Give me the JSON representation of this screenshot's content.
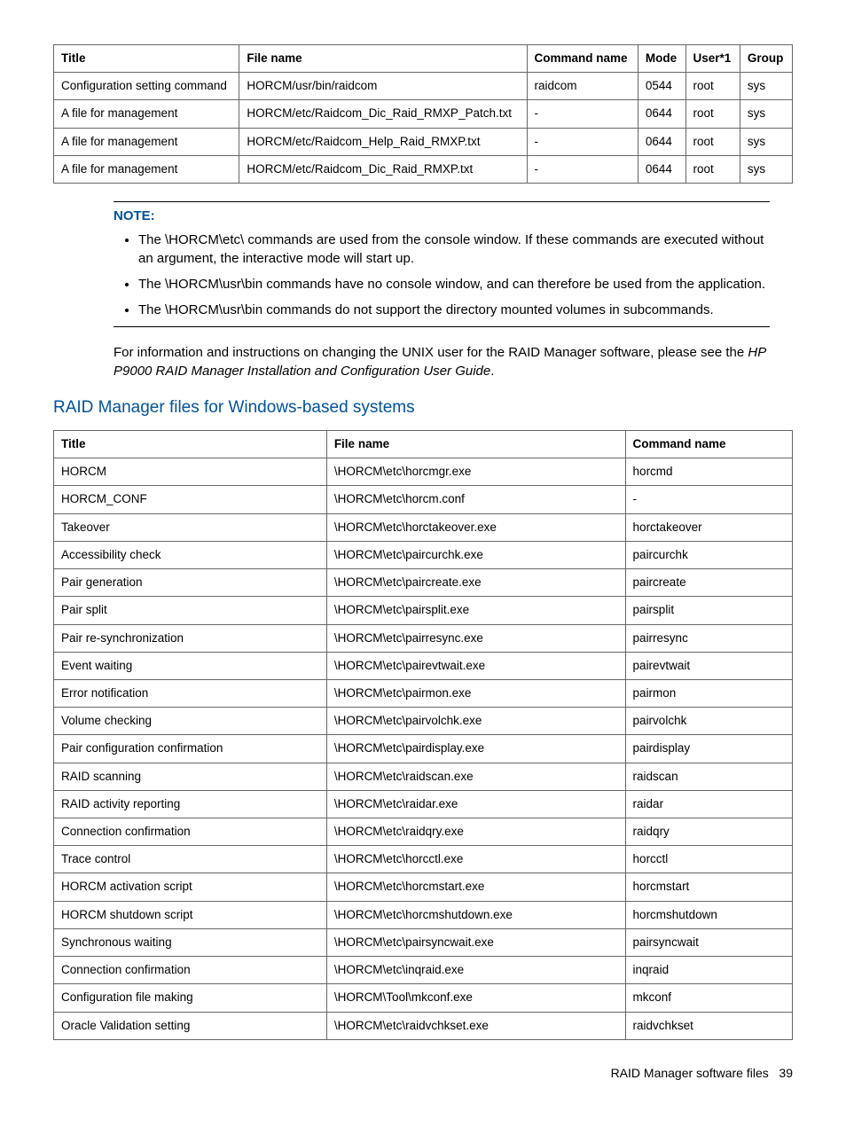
{
  "table1": {
    "headers": [
      "Title",
      "File name",
      "Command name",
      "Mode",
      "User*1",
      "Group"
    ],
    "rows": [
      {
        "c0": "Configuration setting command",
        "c1": "HORCM/usr/bin/raidcom",
        "c2": "raidcom",
        "c3": "0544",
        "c4": "root",
        "c5": "sys"
      },
      {
        "c0": "A file for management",
        "c1": "HORCM/etc/Raidcom_Dic_Raid_RMXP_Patch.txt",
        "c2": "-",
        "c3": "0644",
        "c4": "root",
        "c5": "sys"
      },
      {
        "c0": "A file for management",
        "c1": "HORCM/etc/Raidcom_Help_Raid_RMXP.txt",
        "c2": "-",
        "c3": "0644",
        "c4": "root",
        "c5": "sys"
      },
      {
        "c0": "A file for management",
        "c1": "HORCM/etc/Raidcom_Dic_Raid_RMXP.txt",
        "c2": "-",
        "c3": "0644",
        "c4": "root",
        "c5": "sys"
      }
    ]
  },
  "note": {
    "title": "NOTE:",
    "items": [
      "The \\HORCM\\etc\\ commands are used from the console window. If these commands are executed without an argument, the interactive mode will start up.",
      "The \\HORCM\\usr\\bin commands have no console window, and can therefore be used from the application.",
      "The \\HORCM\\usr\\bin commands do not support the directory mounted volumes in subcommands."
    ]
  },
  "after_note_1": "For information and instructions on changing the UNIX user for the RAID Manager software, please see the ",
  "after_note_doc": "HP P9000 RAID Manager Installation and Configuration User Guide",
  "after_note_2": ".",
  "section_title": "RAID Manager files for Windows-based systems",
  "table2": {
    "headers": [
      "Title",
      "File name",
      "Command name"
    ],
    "rows": [
      {
        "c0": "HORCM",
        "c1": "\\HORCM\\etc\\horcmgr.exe",
        "c2": "horcmd"
      },
      {
        "c0": "HORCM_CONF",
        "c1": "\\HORCM\\etc\\horcm.conf",
        "c2": "-"
      },
      {
        "c0": "Takeover",
        "c1": "\\HORCM\\etc\\horctakeover.exe",
        "c2": "horctakeover"
      },
      {
        "c0": "Accessibility check",
        "c1": "\\HORCM\\etc\\paircurchk.exe",
        "c2": "paircurchk"
      },
      {
        "c0": "Pair generation",
        "c1": "\\HORCM\\etc\\paircreate.exe",
        "c2": "paircreate"
      },
      {
        "c0": "Pair split",
        "c1": "\\HORCM\\etc\\pairsplit.exe",
        "c2": "pairsplit"
      },
      {
        "c0": "Pair re-synchronization",
        "c1": "\\HORCM\\etc\\pairresync.exe",
        "c2": "pairresync"
      },
      {
        "c0": "Event waiting",
        "c1": "\\HORCM\\etc\\pairevtwait.exe",
        "c2": "pairevtwait"
      },
      {
        "c0": "Error notification",
        "c1": "\\HORCM\\etc\\pairmon.exe",
        "c2": "pairmon"
      },
      {
        "c0": "Volume checking",
        "c1": "\\HORCM\\etc\\pairvolchk.exe",
        "c2": "pairvolchk"
      },
      {
        "c0": "Pair configuration confirmation",
        "c1": "\\HORCM\\etc\\pairdisplay.exe",
        "c2": "pairdisplay"
      },
      {
        "c0": "RAID scanning",
        "c1": "\\HORCM\\etc\\raidscan.exe",
        "c2": "raidscan"
      },
      {
        "c0": "RAID activity reporting",
        "c1": "\\HORCM\\etc\\raidar.exe",
        "c2": "raidar"
      },
      {
        "c0": "Connection confirmation",
        "c1": "\\HORCM\\etc\\raidqry.exe",
        "c2": "raidqry"
      },
      {
        "c0": "Trace control",
        "c1": "\\HORCM\\etc\\horcctl.exe",
        "c2": "horcctl"
      },
      {
        "c0": "HORCM activation script",
        "c1": "\\HORCM\\etc\\horcmstart.exe",
        "c2": "horcmstart"
      },
      {
        "c0": "HORCM shutdown script",
        "c1": "\\HORCM\\etc\\horcmshutdown.exe",
        "c2": "horcmshutdown"
      },
      {
        "c0": "Synchronous waiting",
        "c1": "\\HORCM\\etc\\pairsyncwait.exe",
        "c2": "pairsyncwait"
      },
      {
        "c0": "Connection confirmation",
        "c1": "\\HORCM\\etc\\inqraid.exe",
        "c2": "inqraid"
      },
      {
        "c0": "Configuration file making",
        "c1": "\\HORCM\\Tool\\mkconf.exe",
        "c2": "mkconf"
      },
      {
        "c0": "Oracle Validation setting",
        "c1": "\\HORCM\\etc\\raidvchkset.exe",
        "c2": "raidvchkset"
      }
    ]
  },
  "footer": {
    "text": "RAID Manager software files",
    "page": "39"
  }
}
